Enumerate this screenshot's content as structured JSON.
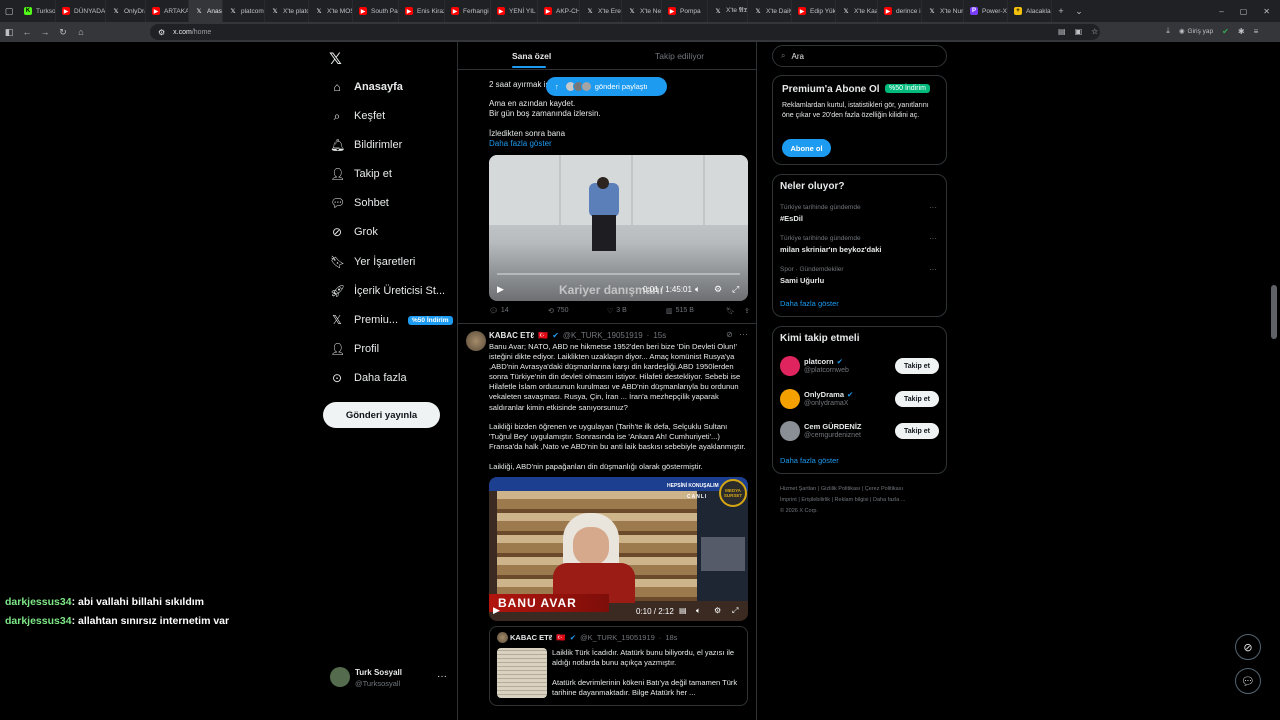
{
  "browser": {
    "tabs": [
      {
        "label": "Turksosyal",
        "icon": "kick"
      },
      {
        "label": "DÜNYADAN",
        "icon": "yt"
      },
      {
        "label": "OnlyDrama",
        "icon": "x"
      },
      {
        "label": "ARTAKALI",
        "icon": "yt"
      },
      {
        "label": "Anasayfa",
        "icon": "x",
        "active": true
      },
      {
        "label": "platcom",
        "icon": "x"
      },
      {
        "label": "X'te platc",
        "icon": "x"
      },
      {
        "label": "X'te MOS",
        "icon": "x"
      },
      {
        "label": "South Park",
        "icon": "yt"
      },
      {
        "label": "Enis Kirazo",
        "icon": "yt"
      },
      {
        "label": "Ferhangi",
        "icon": "yt"
      },
      {
        "label": "YENİ YIL",
        "icon": "yt"
      },
      {
        "label": "AKP-CHP",
        "icon": "yt"
      },
      {
        "label": "X'te Eren",
        "icon": "x"
      },
      {
        "label": "X'te Neco",
        "icon": "x"
      },
      {
        "label": "Pompa",
        "icon": "yt"
      },
      {
        "label": "X'te 𝕬𝕯𝕸",
        "icon": "x"
      },
      {
        "label": "X'te Daily",
        "icon": "x"
      },
      {
        "label": "Edip Yüks",
        "icon": "yt"
      },
      {
        "label": "X'te Kaan",
        "icon": "x"
      },
      {
        "label": "derince i",
        "icon": "yt"
      },
      {
        "label": "X'te Nuru",
        "icon": "x"
      },
      {
        "label": "Power-Xt",
        "icon": "pw"
      },
      {
        "label": "Alacaklar",
        "icon": "ac"
      }
    ],
    "url_host": "x.com",
    "url_path": "/home",
    "login_label": "Giriş yap"
  },
  "nav": {
    "items": [
      {
        "label": "Anasayfa",
        "icon": "home-icon"
      },
      {
        "label": "Keşfet",
        "icon": "search-icon"
      },
      {
        "label": "Bildirimler",
        "icon": "bell-icon"
      },
      {
        "label": "Takip et",
        "icon": "add-user-icon"
      },
      {
        "label": "Sohbet",
        "icon": "chat-icon"
      },
      {
        "label": "Grok",
        "icon": "grok-icon"
      },
      {
        "label": "Yer İşaretleri",
        "icon": "bookmark-icon"
      },
      {
        "label": "İçerik Üreticisi St...",
        "icon": "rocket-icon"
      },
      {
        "label": "Premiu...",
        "icon": "x-icon",
        "badge": "%50 İndirim"
      },
      {
        "label": "Profil",
        "icon": "profile-icon"
      },
      {
        "label": "Daha fazla",
        "icon": "more-icon"
      }
    ],
    "post_button": "Gönderi yayınla",
    "account": {
      "name": "Turk Sosyall",
      "handle": "@Turksosyall"
    }
  },
  "feed": {
    "tabs": [
      "Sana özel",
      "Takip ediliyor"
    ],
    "new_posts_pill": "gönderi paylaştı",
    "tweet1": {
      "line1": "2 saat ayırmak is",
      "line2": "Ama en azından kaydet.",
      "line3": "Bir gün boş zamanında izlersin.",
      "line4": "İzledikten sonra bana",
      "show_more": "Daha fazla göster",
      "video_caption": "Kariyer danışmanı",
      "video_time": "0:01 / 1:45:01",
      "stats": {
        "replies": "14",
        "reposts": "750",
        "likes": "3 B",
        "views": "515 B"
      }
    },
    "tweet2": {
      "name": "KABAC ЕТℓ",
      "handle": "@K_TURK_19051919",
      "time": "15s",
      "paragraph1": "Banu Avar; NATO, ABD ne hikmetse 1952'den beri bize 'Din Devleti Olun!' isteğini dikte ediyor. Laiklikten uzaklaşın diyor... Amaç komünist Rusya'ya ,ABD'nin Avrasya'daki düşmanlarına karşı din kardeşliği.ABD 1950lerden sonra Türkiye'nin din devleti olmasını istiyor. Hilafeti destekliyor. Sebebi ise Hilafetle İslam ordusunun kurulması ve ABD'nin düşmanlarıyla bu ordunun vekaleten savaşması. Rusya, Çin, İran ... İran'a mezhepçilik yaparak saldıranlar kimin etkisinde sanıyorsunuz?",
      "paragraph2": "Laikliği bizden öğrenen ve uygulayan (Tarih'te ilk defa, Selçuklu Sultanı 'Tuğrul Bey' uygulamıştır. Sonrasında ise 'Ankara Ah! Cumhuriyeti'...) Fransa'da halk ,Nato ve ABD'nin bu anti laik baskısı sebebiyle ayaklanmıştır.",
      "paragraph3": "Laikliği, ABD'nin papağanları din düşmanlığı olarak göstermiştir.",
      "video_lower_third": "BANU AVAR",
      "video_badge": "HEPSİNİ KONUŞALIM",
      "video_live": "CANLI",
      "video_logo": "MEDYA SURSET",
      "video_time": "0:10 / 2:12"
    },
    "quoted": {
      "name": "KABAC ЕТℓ",
      "handle": "@K_TURK_19051919",
      "time": "18s",
      "text1": "Laiklik Türk İcadıdır. Atatürk bunu biliyordu, el yazısı ile aldığı notlarda bunu açıkça yazmıştır.",
      "text2": "Atatürk devrimlerinin kökeni Batı'ya değil tamamen Türk tarihine dayanmaktadır.  Bilge Atatürk her ..."
    }
  },
  "right": {
    "search_placeholder": "Ara",
    "premium": {
      "title": "Premium'a Abone Ol",
      "badge": "%50 İndirim",
      "text": "Reklamlardan kurtul, istatistikleri gör, yanıtlarını öne çıkar ve 20'den fazla özelliğin kilidini aç.",
      "button": "Abone ol"
    },
    "trends": {
      "title": "Neler oluyor?",
      "items": [
        {
          "context": "Türkiye tarihinde gündemde",
          "topic": "#EsDil"
        },
        {
          "context": "Türkiye tarihinde gündemde",
          "topic": "milan skriniar'ın beykoz'daki"
        },
        {
          "context": "Spor · Gündemdekiler",
          "topic": "Sami Uğurlu"
        }
      ],
      "show_more": "Daha fazla göster"
    },
    "who_to_follow": {
      "title": "Kimi takip etmeli",
      "users": [
        {
          "name": "platcorn",
          "handle": "@platcornweb",
          "verified": true,
          "color": "#e0245e"
        },
        {
          "name": "OnlyDrama",
          "handle": "@onlydramaX",
          "verified": true,
          "color": "#f4a000"
        },
        {
          "name": "Cem GÜRDENİZ",
          "handle": "@cemgurdeniznet",
          "verified": false,
          "color": "#8a8f95"
        }
      ],
      "follow_label": "Takip et",
      "show_more": "Daha fazla göster"
    },
    "footer": {
      "row1": [
        "Hizmet Şartları",
        "Gizlilik Politikası",
        "Çerez Politikası"
      ],
      "row2": [
        "İmprint",
        "Erişilebilirlik",
        "Reklam bilgisi",
        "Daha fazla ..."
      ],
      "copyright": "© 2026 X Corp."
    }
  },
  "stream_chat": [
    {
      "user": "darkjessus34",
      "message": ": abi vallahi billahi sıkıldım"
    },
    {
      "user": "darkjessus34",
      "message": ": allahtan sınırsız internetim var"
    }
  ]
}
